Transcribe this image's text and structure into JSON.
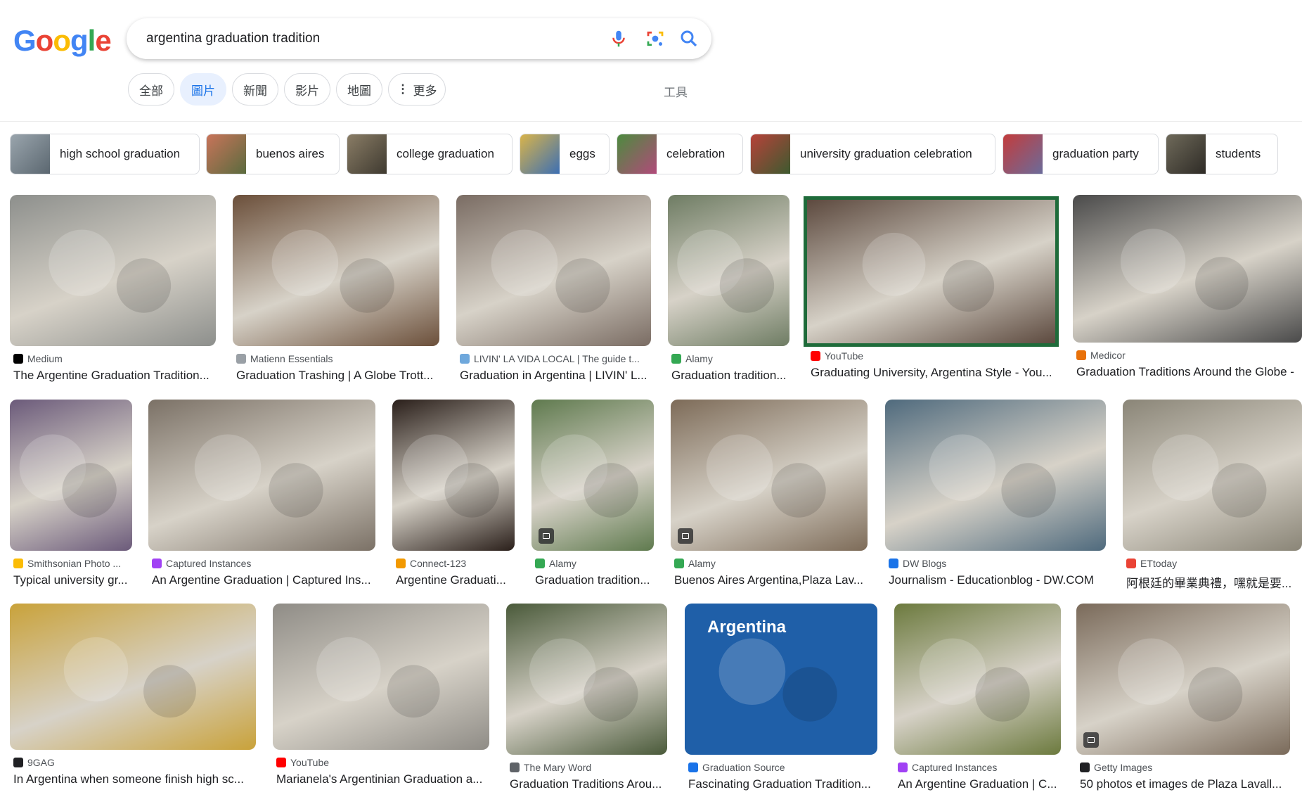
{
  "logo": {
    "letters": [
      "G",
      "o",
      "o",
      "g",
      "l",
      "e"
    ],
    "colors": [
      "#4285F4",
      "#EA4335",
      "#FBBC05",
      "#4285F4",
      "#34A853",
      "#EA4335"
    ]
  },
  "search": {
    "query": "argentina graduation tradition",
    "icons": [
      "mic-icon",
      "camera-lens-icon",
      "search-icon"
    ]
  },
  "tabs": [
    "全部",
    "圖片",
    "新聞",
    "影片",
    "地圖",
    "更多"
  ],
  "active_tab": "圖片",
  "tools_label": "工具",
  "chips": [
    "high school graduation",
    "buenos aires",
    "college graduation",
    "eggs",
    "celebration",
    "university graduation celebration",
    "graduation party",
    "students"
  ],
  "results": [
    {
      "source": "Medium",
      "title": "The Argentine Graduation Tradition...",
      "fav": "#000000",
      "img": "#8d8f8c"
    },
    {
      "source": "Matienn Essentials",
      "title": "Graduation Trashing | A Globe Trott...",
      "fav": "#9aa0a6",
      "img": "#6b4f3a"
    },
    {
      "source": "LIVIN' LA VIDA LOCAL | The guide t...",
      "title": "Graduation in Argentina | LIVIN' L...",
      "fav": "#6fa8dc",
      "img": "#7a6c63"
    },
    {
      "source": "Alamy",
      "title": "Graduation tradition...",
      "fav": "#34a853",
      "img": "#6e7c63"
    },
    {
      "source": "YouTube",
      "title": "Graduating University, Argentina Style - You...",
      "fav": "#ff0000",
      "img": "#5d4a3f"
    },
    {
      "source": "Medicor",
      "title": "Graduation Traditions Around the Globe -",
      "fav": "#e8710a",
      "img": "#4a4a4a"
    },
    {
      "source": "Smithsonian Photo ...",
      "title": "Typical university gr...",
      "fav": "#fbbc05",
      "img": "#6b5a7a"
    },
    {
      "source": "Captured Instances",
      "title": "An Argentine Graduation | Captured Ins...",
      "fav": "#a142f4",
      "img": "#7b7166"
    },
    {
      "source": "Connect-123",
      "title": "Argentine Graduati...",
      "fav": "#f29900",
      "img": "#2a1f1a"
    },
    {
      "source": "Alamy",
      "title": "Graduation tradition...",
      "fav": "#34a853",
      "img": "#5f7a4e"
    },
    {
      "source": "Alamy",
      "title": "Buenos Aires Argentina,Plaza Lav...",
      "fav": "#34a853",
      "img": "#7d6b58"
    },
    {
      "source": "DW Blogs",
      "title": "Journalism - Educationblog - DW.COM",
      "fav": "#1a73e8",
      "img": "#4f6a7d"
    },
    {
      "source": "ETtoday",
      "title": "阿根廷的畢業典禮，嘿就是要...",
      "fav": "#ea4335",
      "img": "#8a8577"
    },
    {
      "source": "9GAG",
      "title": "In Argentina when someone finish high sc...",
      "fav": "#202124",
      "img": "#c9a23a"
    },
    {
      "source": "YouTube",
      "title": "Marianela's Argentinian Graduation a...",
      "fav": "#ff0000",
      "img": "#8f8c86"
    },
    {
      "source": "The Mary Word",
      "title": "Graduation Traditions Arou...",
      "fav": "#5f6368",
      "img": "#4a5a3a"
    },
    {
      "source": "Graduation Source",
      "title": "Fascinating Graduation Tradition...",
      "fav": "#1a73e8",
      "img": "#1f5fa8",
      "overlay_text": "Argentina"
    },
    {
      "source": "Captured Instances",
      "title": "An Argentine Graduation | C...",
      "fav": "#a142f4",
      "img": "#6c7a3e"
    },
    {
      "source": "Getty Images",
      "title": "50 photos et images de Plaza Lavall...",
      "fav": "#202124",
      "img": "#7a6a5a"
    }
  ]
}
